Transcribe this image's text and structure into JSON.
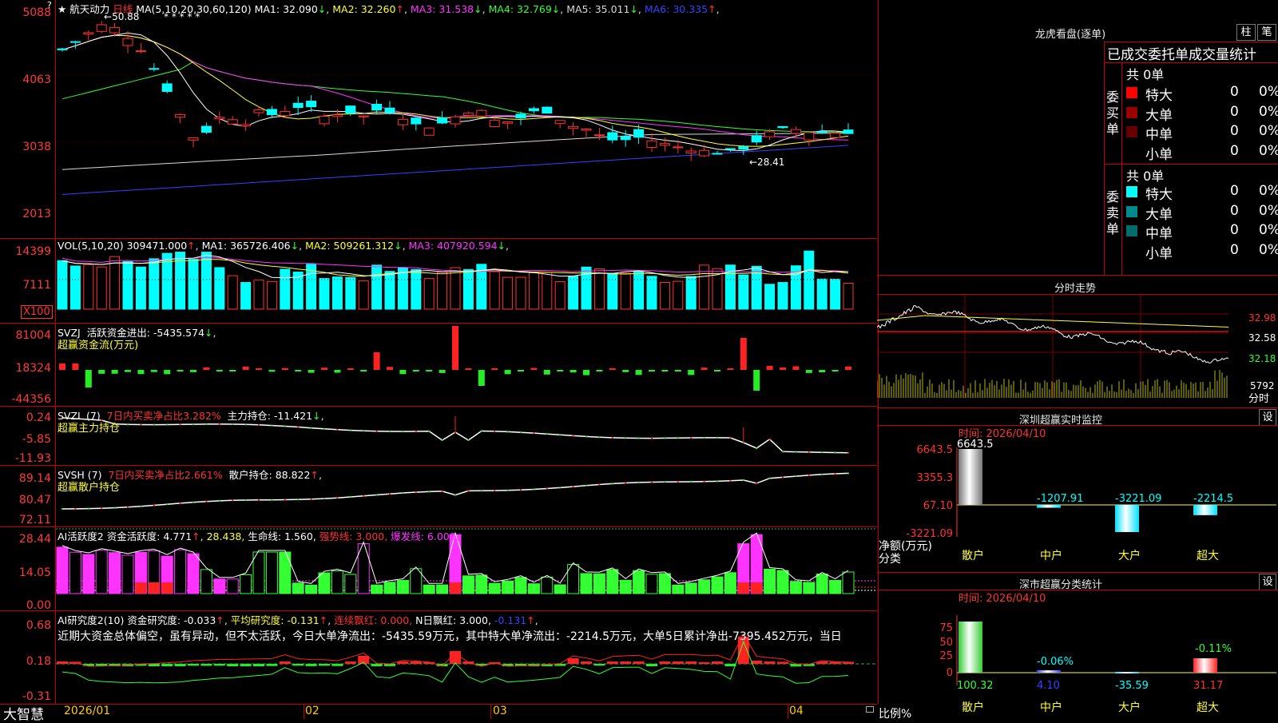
{
  "app": {
    "brand": "大智慧",
    "stock_name": "航天动力",
    "period": "日线",
    "star": "★",
    "date_marks": [
      "2026/01",
      "02",
      "03",
      "04"
    ]
  },
  "colors": {
    "red": "#ff3333",
    "cyan": "#00ffff",
    "green": "#33ff33",
    "yellow": "#ffff33",
    "magenta": "#ff33ff",
    "grid": "#b00000"
  },
  "main_chart": {
    "title_ma": "MA(5,10,20,30,60,120)",
    "ma_items": [
      {
        "label": "MA1: 32.090",
        "arrow": "↓",
        "color": "#ffffff"
      },
      {
        "label": "MA2: 32.260",
        "arrow": "↑",
        "color": "#ffff33"
      },
      {
        "label": "MA3: 31.538",
        "arrow": "↓",
        "color": "#ff33ff"
      },
      {
        "label": "MA4: 32.769",
        "arrow": "↓",
        "color": "#33ff33"
      },
      {
        "label": "MA5: 35.011",
        "arrow": "↓",
        "color": "#d8d8d8"
      },
      {
        "label": "MA6: 30.335",
        "arrow": "↑",
        "color": "#3344ff"
      }
    ],
    "y_ticks": [
      "5088",
      "4063",
      "3038",
      "2013"
    ],
    "high_label": "50.88",
    "low_label": "←28.41",
    "stars": "* * * *   *"
  },
  "vol_panel": {
    "title": "VOL(5,10,20)",
    "value": "309471.000",
    "value_arrow": "↑",
    "ma_items": [
      {
        "label": "MA1: 365726.406",
        "arrow": "↓",
        "color": "#ffffff"
      },
      {
        "label": "MA2: 509261.312",
        "arrow": "↓",
        "color": "#ffff33"
      },
      {
        "label": "MA3: 407920.594",
        "arrow": "↓",
        "color": "#ff33ff"
      }
    ],
    "y_ticks": [
      "14399",
      "7111"
    ],
    "unit": "X100"
  },
  "svzj_panel": {
    "title": "SVZJ",
    "desc": "活跃资金进出: -5435.574",
    "desc_arrow": "↓",
    "sub": "超赢资金流(万元)",
    "y_ticks": [
      "81004",
      "18324",
      "-44356"
    ]
  },
  "svzl_panel": {
    "title": "SVZL (7)",
    "desc1": "7日内买卖净占比3.282%",
    "desc2": "主力持仓: -11.421",
    "desc2_arrow": "↓",
    "sub": "超赢主力持仓",
    "y_ticks": [
      "0.24",
      "-5.85",
      "-11.93"
    ]
  },
  "svsh_panel": {
    "title": "SVSH (7)",
    "desc1": "7日内买卖净占比2.661%",
    "desc2": "散户持仓: 88.822",
    "desc2_arrow": "↑",
    "sub": "超赢散户持仓",
    "y_ticks": [
      "89.14",
      "80.47",
      "72.11"
    ]
  },
  "ai_active_panel": {
    "title": "AI活跃度2",
    "items": [
      {
        "label": "资金活跃度: 4.771",
        "arrow": "↑",
        "color": "#ffffff"
      },
      {
        "label": "28.438",
        "arrow": ",",
        "color": "#ffff33"
      },
      {
        "label": "生命线: 1.560",
        "arrow": ",",
        "color": "#ffffff"
      },
      {
        "label": "强势线: 3.000",
        "arrow": ",",
        "color": "#ff3333"
      },
      {
        "label": "爆发线: 6.000",
        "arrow": ",",
        "color": "#ff33ff"
      }
    ],
    "y_ticks": [
      "28.44",
      "14.05",
      "0.00"
    ]
  },
  "ai_research_panel": {
    "title": "AI研究度2(10)",
    "items": [
      {
        "label": "资金研究度: -0.033",
        "arrow": "↑",
        "color": "#ffffff"
      },
      {
        "label": "平均研究度: -0.131",
        "arrow": "↑",
        "color": "#ffff33"
      },
      {
        "label": "连续飘红: 0.000",
        "arrow": ",",
        "color": "#ff3333"
      },
      {
        "label": "N日飘红: 3.000",
        "arrow": ",",
        "color": "#ffffff"
      },
      {
        "label": "-0.131",
        "arrow": "↑",
        "color": "#3344ff"
      }
    ],
    "commentary": "近期大资金总体偏空，虽有异动，但不太活跃，今日大单净流出：-5435.59万元，其中特大单净流出：-2214.5万元，大单5日累计净出-7395.452万元，当日",
    "y_ticks": [
      "0.68",
      "0.18",
      "-0.31"
    ]
  },
  "right": {
    "lhb": {
      "title": "龙虎看盘(逐单)",
      "btn_zhu": "柱",
      "btn_bi": "笔",
      "header": "已成交委托单成交量统计",
      "buy": {
        "side": "委买单",
        "total": "共 0单",
        "rows": [
          {
            "name": "特大",
            "val": "0",
            "pct": "0%",
            "color": "#ff0000"
          },
          {
            "name": "大单",
            "val": "0",
            "pct": "0%",
            "color": "#990000"
          },
          {
            "name": "中单",
            "val": "0",
            "pct": "0%",
            "color": "#660000"
          },
          {
            "name": "小单",
            "val": "0",
            "pct": "0%",
            "color": "#000000"
          }
        ]
      },
      "sell": {
        "side": "委卖单",
        "total": "共 0单",
        "rows": [
          {
            "name": "特大",
            "val": "0",
            "pct": "0%",
            "color": "#00ffff"
          },
          {
            "name": "大单",
            "val": "0",
            "pct": "0%",
            "color": "#008b8b"
          },
          {
            "name": "中单",
            "val": "0",
            "pct": "0%",
            "color": "#006d6d"
          },
          {
            "name": "小单",
            "val": "0",
            "pct": "0%",
            "color": "#000000"
          }
        ]
      }
    },
    "intraday": {
      "title": "分时走势",
      "y_ticks": [
        "32.98",
        "32.58",
        "32.18"
      ],
      "vol_tick": "5792",
      "vol_unit": "分时"
    },
    "sz_monitor": {
      "title": "深圳超赢实时监控",
      "btn": "设",
      "time": "时间: 2026/04/10",
      "y_ticks": [
        "6643.5",
        "3355.3",
        "67.10",
        "-3221.09"
      ],
      "ylabel": "净额(万元)",
      "xlabel": "分类",
      "categories": [
        "散户",
        "中户",
        "大户",
        "超大"
      ],
      "values": [
        6643.5,
        -1207.91,
        -3221.09,
        -2214.5
      ],
      "value_labels": [
        "6643.5",
        "-1207.91",
        "-3221.09",
        "-2214.5"
      ]
    },
    "sz_class": {
      "title": "深市超赢分类统计",
      "btn": "设",
      "time": "时间: 2026/04/10",
      "y_ticks": [
        "75",
        "50",
        "25",
        "0"
      ],
      "ylabel": "比例%",
      "xlabel": "分类",
      "categories": [
        "散户",
        "中户",
        "大户",
        "超大"
      ],
      "values": [
        100.32,
        4.1,
        -35.59,
        31.17
      ],
      "value_labels": [
        "100.32",
        "4.10",
        "-35.59",
        "31.17"
      ],
      "top_labels": [
        "-0.06%",
        "-0.11%"
      ]
    }
  }
}
